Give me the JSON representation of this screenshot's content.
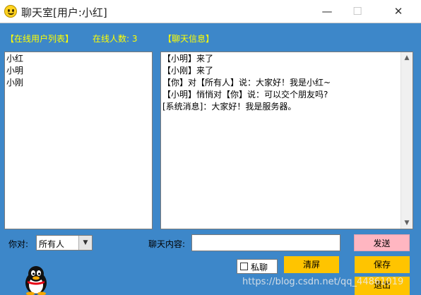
{
  "window": {
    "title": "聊天室[用户:小红]",
    "icon": "smiley-icon",
    "minimize_glyph": "—",
    "maximize_glyph": "☐",
    "close_glyph": "✕"
  },
  "headers": {
    "user_list": "【在线用户列表】",
    "online_count": "在线人数: 3",
    "chat_info": "【聊天信息】"
  },
  "users": [
    "小红",
    "小明",
    "小刚"
  ],
  "messages": [
    "【小明】来了",
    "【小刚】来了",
    "【你】对【所有人】说：大家好！我是小红~",
    "【小明】悄悄对【你】说：可以交个朋友吗?",
    "[系统消息]：大家好！我是服务器。"
  ],
  "controls": {
    "to_label": "你对:",
    "to_selected": "所有人",
    "content_label": "聊天内容:",
    "message_value": "",
    "send": "发送",
    "private_label": "私聊",
    "private_checked": false,
    "clear": "清屏",
    "save": "保存",
    "exit": "退出"
  },
  "avatar_icon": "qq-penguin-icon",
  "watermark": "https://blog.csdn.net/qq_44861019",
  "colors": {
    "background": "#3d87c9",
    "header_text": "#ffff00",
    "send_button": "#ffb6c1",
    "action_buttons": "#ffc400"
  }
}
